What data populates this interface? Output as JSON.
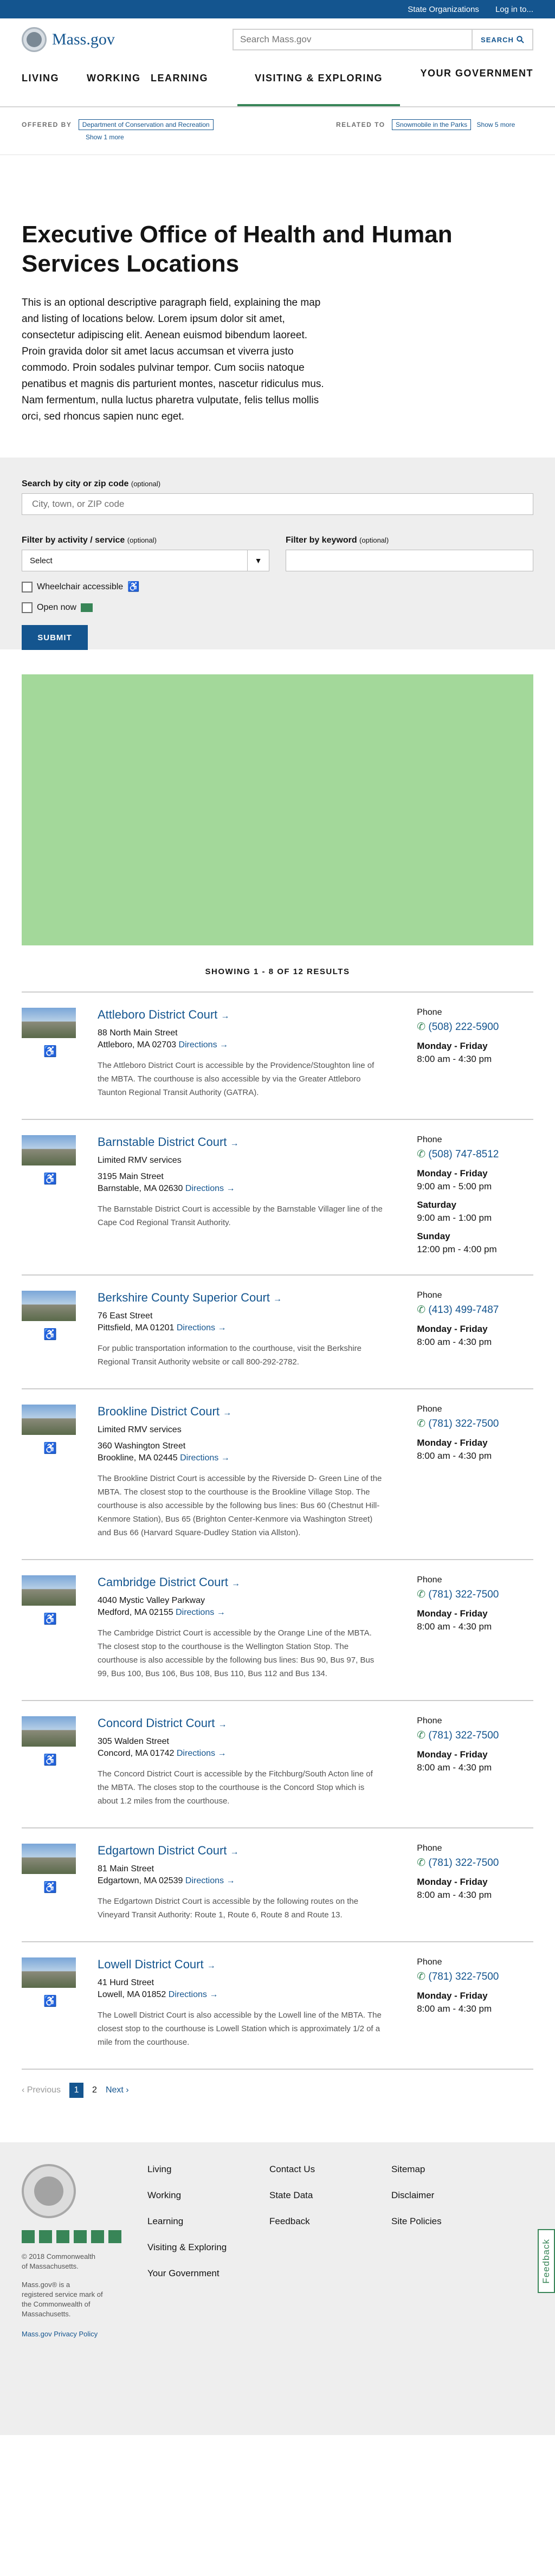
{
  "utility": {
    "state_orgs": "State Organizations",
    "login": "Log in to..."
  },
  "header": {
    "logo_text": "Mass.gov",
    "search_placeholder": "Search Mass.gov",
    "search_button": "SEARCH"
  },
  "nav": {
    "items": [
      "LIVING",
      "WORKING",
      "LEARNING",
      "VISITING & EXPLORING",
      "YOUR GOVERNMENT"
    ]
  },
  "org_bar": {
    "offered_by_label": "OFFERED BY",
    "offered_by_value": "Department of Conservation and Recreation",
    "offered_more": "Show 1 more",
    "related_label": "RELATED TO",
    "related_value": "Snowmobile in the Parks",
    "related_more": "Show 5 more"
  },
  "page": {
    "title": "Executive Office of Health and Human Services Locations",
    "description": "This is an optional descriptive paragraph field, explaining the map and listing of locations below. Lorem ipsum dolor sit amet, consectetur adipiscing elit. Aenean euismod bibendum laoreet. Proin gravida dolor sit amet lacus accumsan et viverra justo commodo. Proin sodales pulvinar tempor. Cum sociis natoque penatibus et magnis dis parturient montes, nascetur ridiculus mus. Nam fermentum, nulla luctus pharetra vulputate, felis tellus mollis orci, sed rhoncus sapien nunc eget."
  },
  "filter": {
    "search_label": "Search by city or zip code",
    "optional": "(optional)",
    "search_placeholder": "City, town, or ZIP code",
    "activity_label": "Filter by activity / service",
    "activity_value": "Select",
    "keyword_label": "Filter by keyword",
    "wheelchair": "Wheelchair accessible",
    "open_now": "Open now",
    "submit": "SUBMIT"
  },
  "results_header": "SHOWING 1 - 8 OF 12 RESULTS",
  "results": [
    {
      "name": "Attleboro District Court",
      "sub": "",
      "street": "88 North Main Street",
      "city": "Attleboro, MA 02703",
      "directions": "Directions",
      "desc": "The Attleboro District Court is accessible by the Providence/Stoughton line of the MBTA. The courthouse is also accessible by via the Greater Attleboro Taunton Regional Transit Authority (GATRA).",
      "phone_label": "Phone",
      "phone": "(508) 222-5900",
      "hours": [
        {
          "day": "Monday - Friday",
          "time": "8:00 am - 4:30 pm"
        }
      ]
    },
    {
      "name": "Barnstable District Court",
      "sub": "Limited RMV services",
      "street": "3195 Main Street",
      "city": "Barnstable, MA 02630",
      "directions": "Directions",
      "desc": "The Barnstable District Court is accessible by the Barnstable Villager line of the Cape Cod Regional Transit Authority.",
      "phone_label": "Phone",
      "phone": "(508) 747-8512",
      "hours": [
        {
          "day": "Monday - Friday",
          "time": "9:00 am - 5:00 pm"
        },
        {
          "day": "Saturday",
          "time": "9:00 am - 1:00 pm"
        },
        {
          "day": "Sunday",
          "time": "12:00 pm - 4:00 pm"
        }
      ]
    },
    {
      "name": "Berkshire County Superior Court",
      "sub": "",
      "street": "76 East Street",
      "city": "Pittsfield, MA 01201",
      "directions": "Directions",
      "desc": "For public transportation information to the courthouse, visit the Berkshire Regional Transit Authority website or call 800-292-2782.",
      "phone_label": "Phone",
      "phone": "(413) 499-7487",
      "hours": [
        {
          "day": "Monday - Friday",
          "time": "8:00 am - 4:30 pm"
        }
      ]
    },
    {
      "name": "Brookline District Court",
      "sub": "Limited RMV services",
      "street": "360 Washington Street",
      "city": "Brookline, MA 02445",
      "directions": "Directions",
      "desc": "The Brookline District Court is accessible by the Riverside D- Green Line of the MBTA. The closest stop to the courthouse is the Brookline Village Stop. The courthouse is also accessible by the following bus lines: Bus 60 (Chestnut Hill-Kenmore Station), Bus 65 (Brighton Center-Kenmore via Washington Street) and Bus 66 (Harvard Square-Dudley Station via Allston).",
      "phone_label": "Phone",
      "phone": "(781) 322-7500",
      "hours": [
        {
          "day": "Monday - Friday",
          "time": "8:00 am - 4:30 pm"
        }
      ]
    },
    {
      "name": "Cambridge District Court",
      "sub": "",
      "street": "4040 Mystic Valley Parkway",
      "city": "Medford, MA 02155",
      "directions": "Directions",
      "desc": "The Cambridge District Court is accessible by the Orange Line of the MBTA. The closest stop to the courthouse is the Wellington Station Stop. The courthouse is also accessible by the following bus lines: Bus 90, Bus 97, Bus 99, Bus 100, Bus 106, Bus 108, Bus 110, Bus 112 and Bus 134.",
      "phone_label": "Phone",
      "phone": "(781) 322-7500",
      "hours": [
        {
          "day": "Monday - Friday",
          "time": "8:00 am - 4:30 pm"
        }
      ]
    },
    {
      "name": "Concord District Court",
      "sub": "",
      "street": "305 Walden Street",
      "city": "Concord, MA 01742",
      "directions": "Directions",
      "desc": "The Concord District Court is accessible by the Fitchburg/South Acton line of the MBTA. The closes stop to the courthouse is the Concord Stop which is about 1.2 miles from the courthouse.",
      "phone_label": "Phone",
      "phone": "(781) 322-7500",
      "hours": [
        {
          "day": "Monday - Friday",
          "time": "8:00 am - 4:30 pm"
        }
      ]
    },
    {
      "name": "Edgartown District Court",
      "sub": "",
      "street": "81 Main Street",
      "city": "Edgartown, MA 02539",
      "directions": "Directions",
      "desc": "The Edgartown District Court is accessible by the following routes on the Vineyard Transit Authority: Route 1, Route 6, Route 8 and Route 13.",
      "phone_label": "Phone",
      "phone": "(781) 322-7500",
      "hours": [
        {
          "day": "Monday - Friday",
          "time": "8:00 am - 4:30 pm"
        }
      ]
    },
    {
      "name": "Lowell District Court",
      "sub": "",
      "street": "41 Hurd Street",
      "city": "Lowell, MA 01852",
      "directions": "Directions",
      "desc": "The Lowell District Court is also accessible by the Lowell line of the MBTA. The closest stop to the courthouse is Lowell Station which is approximately 1/2 of a mile from the courthouse.",
      "phone_label": "Phone",
      "phone": "(781) 322-7500",
      "hours": [
        {
          "day": "Monday - Friday",
          "time": "8:00 am - 4:30 pm"
        }
      ]
    }
  ],
  "pager": {
    "previous": "Previous",
    "page1": "1",
    "page2": "2",
    "next": "Next"
  },
  "footer": {
    "legal1": "© 2018 Commonwealth of Massachusetts.",
    "legal2": "Mass.gov® is a registered service mark of the Commonwealth of Massachusetts.",
    "privacy": "Mass.gov Privacy Policy",
    "col1": [
      "Living",
      "Working",
      "Learning",
      "Visiting & Exploring",
      "Your Government"
    ],
    "col2": [
      "Contact Us",
      "State Data",
      "Feedback"
    ],
    "col3": [
      "Sitemap",
      "Disclaimer",
      "Site Policies"
    ],
    "feedback_tab": "Feedback"
  },
  "colors": {
    "brand_blue": "#14558f",
    "green": "#388557",
    "map_green": "#a3d89a"
  }
}
